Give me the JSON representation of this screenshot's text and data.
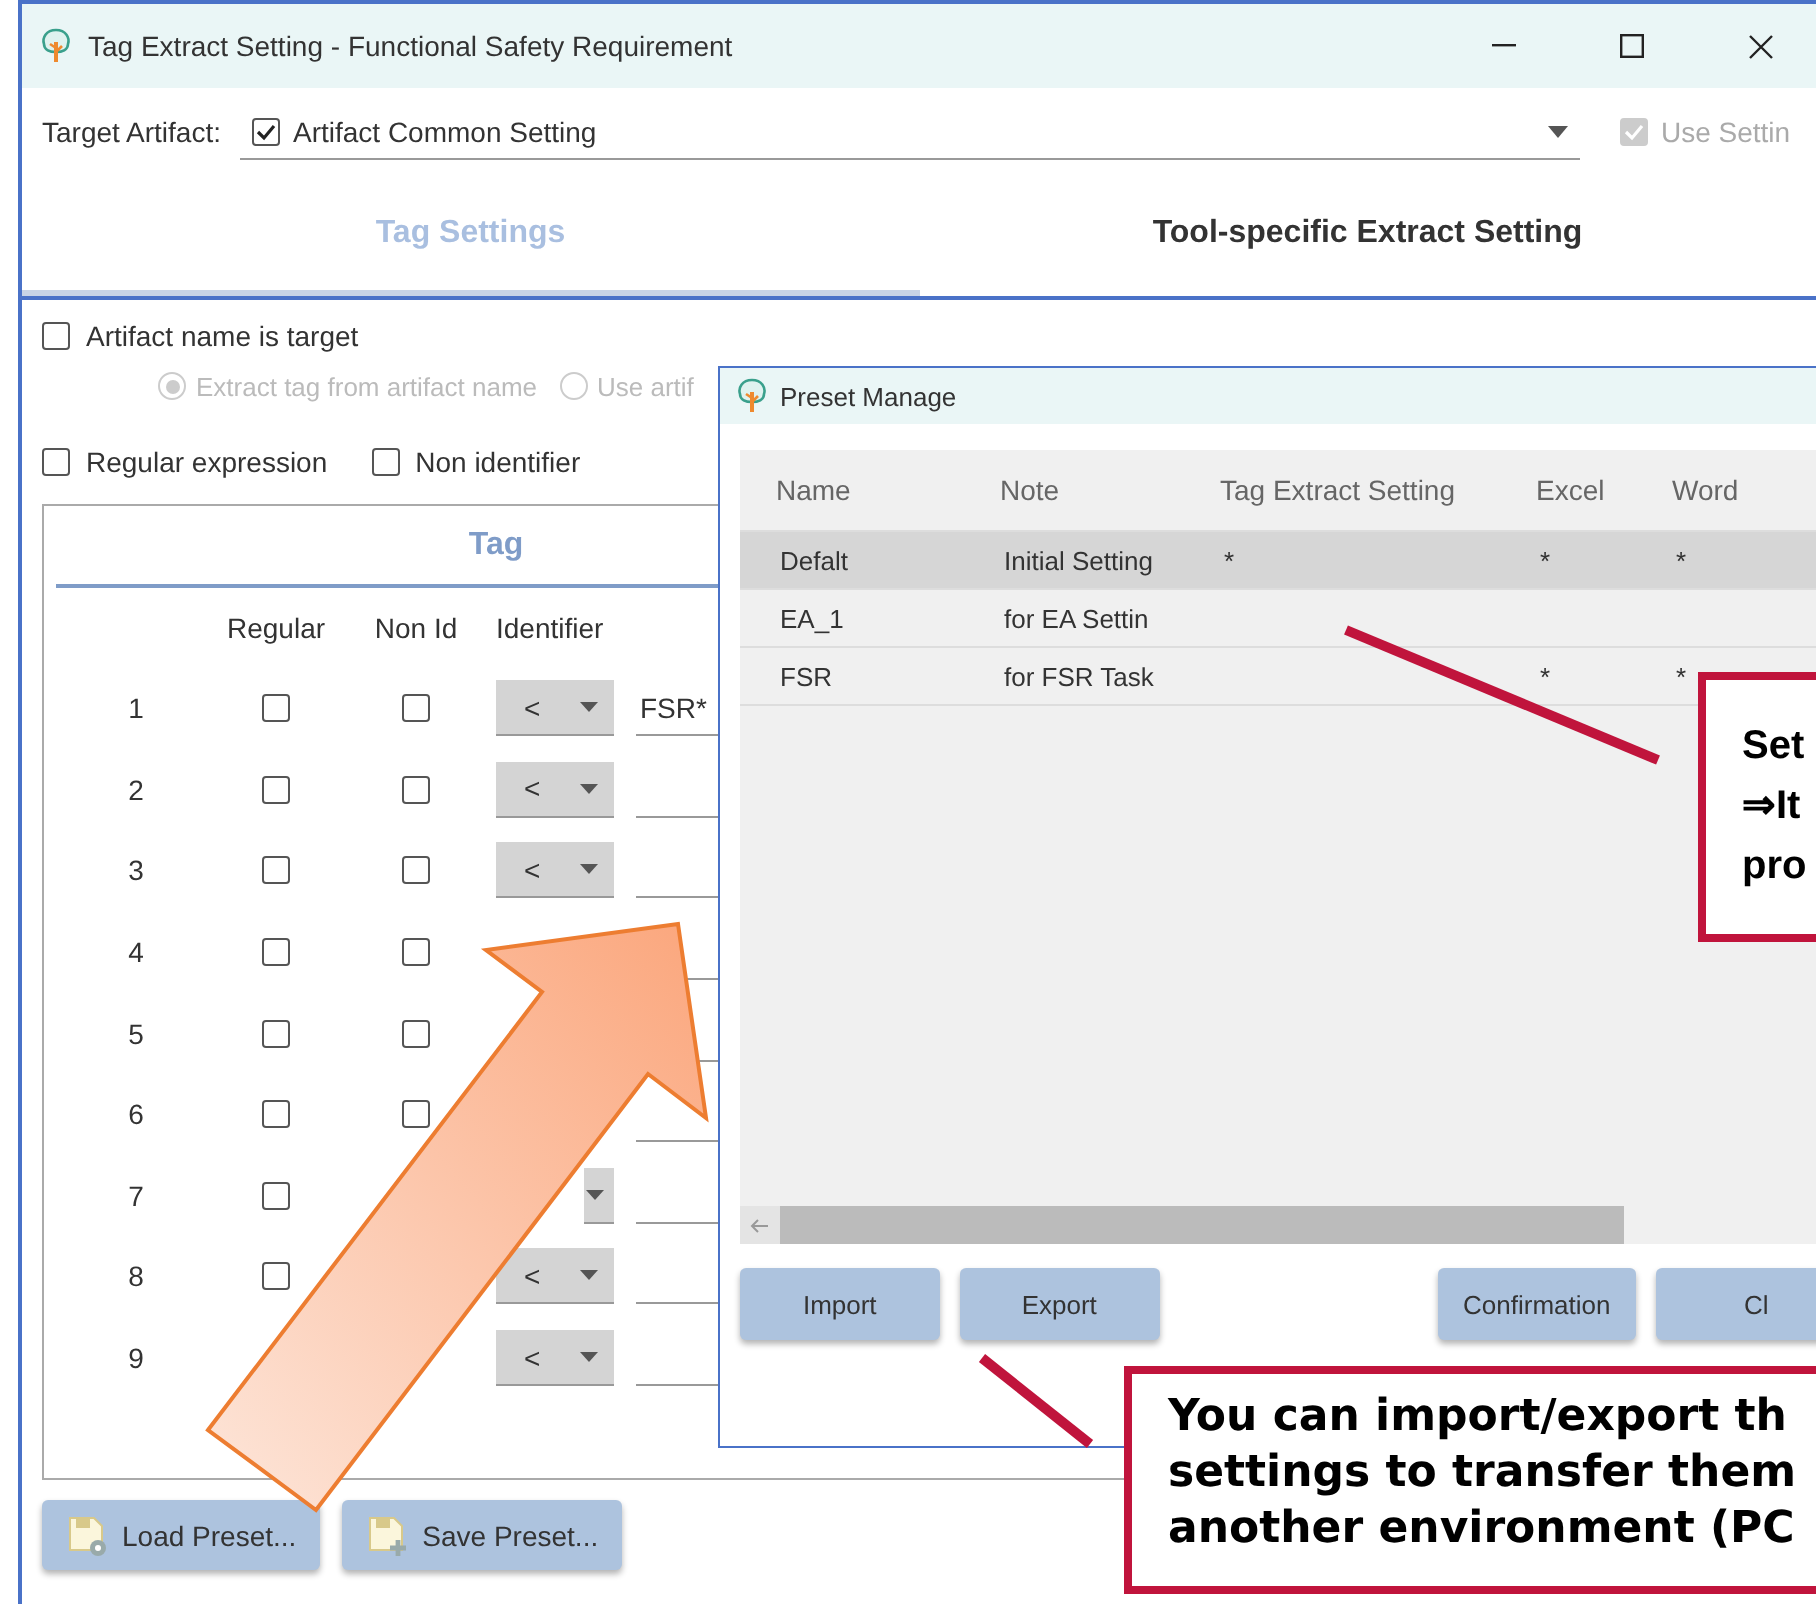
{
  "window": {
    "title": "Tag Extract Setting - Functional Safety Requirement"
  },
  "target_artifact": {
    "label": "Target Artifact:",
    "value": "Artifact Common Setting",
    "value_checked": true,
    "use_setting": {
      "label": "Use Settin",
      "checked": true,
      "disabled": true
    }
  },
  "tabs": [
    {
      "label": "Tag Settings",
      "selected": true
    },
    {
      "label": "Tool-specific Extract Setting",
      "selected": false
    }
  ],
  "artifact_name_is_target": {
    "label": "Artifact name is target",
    "checked": false
  },
  "name_source": [
    {
      "label": "Extract tag from artifact name",
      "selected": true,
      "disabled": true
    },
    {
      "label": "Use artif",
      "selected": false,
      "disabled": true
    }
  ],
  "options": [
    {
      "label": "Regular expression",
      "checked": false
    },
    {
      "label": "Non identifier",
      "checked": false
    }
  ],
  "tag_table": {
    "title": "Tag",
    "columns": [
      "Regular",
      "Non Id",
      "Identifier"
    ],
    "rows": [
      {
        "number": "1",
        "regular": false,
        "non_id": false,
        "identifier": "<",
        "value": "FSR*"
      },
      {
        "number": "2",
        "regular": false,
        "non_id": false,
        "identifier": "<",
        "value": ""
      },
      {
        "number": "3",
        "regular": false,
        "non_id": false,
        "identifier": "<",
        "value": ""
      },
      {
        "number": "4",
        "regular": false,
        "non_id": false,
        "value": ""
      },
      {
        "number": "5",
        "regular": false,
        "non_id": false,
        "value": ""
      },
      {
        "number": "6",
        "regular": false,
        "non_id": false,
        "value": ""
      },
      {
        "number": "7",
        "regular": false,
        "caret_visible": true,
        "value": ""
      },
      {
        "number": "8",
        "regular": false,
        "identifier": "<",
        "value": ""
      },
      {
        "number": "9",
        "identifier": "<",
        "value": ""
      }
    ]
  },
  "buttons": [
    {
      "label": "Load Preset...",
      "kind": "load"
    },
    {
      "label": "Save Preset...",
      "kind": "save"
    }
  ],
  "preset_dialog": {
    "title": "Preset Manage",
    "columns": [
      "Name",
      "Note",
      "Tag Extract Setting",
      "Excel",
      "Word"
    ],
    "rows": [
      {
        "name": "Defalt",
        "note": "Initial Setting",
        "tag_extract_setting": "*",
        "excel": "*",
        "word": "*",
        "selected": true
      },
      {
        "name": "EA_1",
        "note": "for EA Settin",
        "tag_extract_setting": "",
        "excel": "",
        "word": "",
        "selected": false
      },
      {
        "name": "FSR",
        "note": "for FSR Task",
        "tag_extract_setting": "",
        "excel": "*",
        "word": "*",
        "selected": false
      }
    ],
    "buttons": [
      "Import",
      "Export",
      "Confirmation",
      "Cl"
    ]
  },
  "callouts": [
    {
      "lines": [
        "Set",
        "⇒It",
        "pro"
      ]
    },
    {
      "lines": [
        "You can import/export th",
        "settings to transfer them",
        "another environment (PC"
      ]
    }
  ]
}
